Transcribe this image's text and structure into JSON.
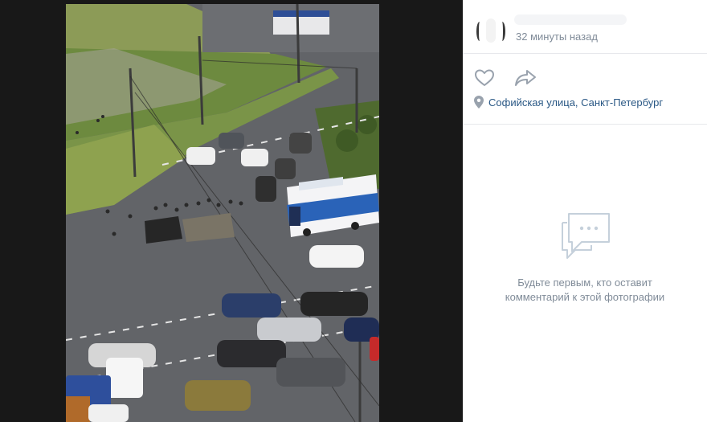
{
  "photo": {
    "description_icon": "street-photo"
  },
  "post": {
    "time": "32 минуты назад",
    "location": "Софийская улица, Санкт-Петербург"
  },
  "actions": {
    "like_icon": "heart-icon",
    "share_icon": "share-arrow-icon",
    "location_icon": "pin-icon"
  },
  "comments": {
    "empty_line1": "Будьте первым, кто оставит",
    "empty_line2": "комментарий к этой фотографии"
  },
  "colors": {
    "link": "#2a5885",
    "muted": "#818c99",
    "icon": "#99a2ad",
    "divider": "#e7e8ec"
  }
}
